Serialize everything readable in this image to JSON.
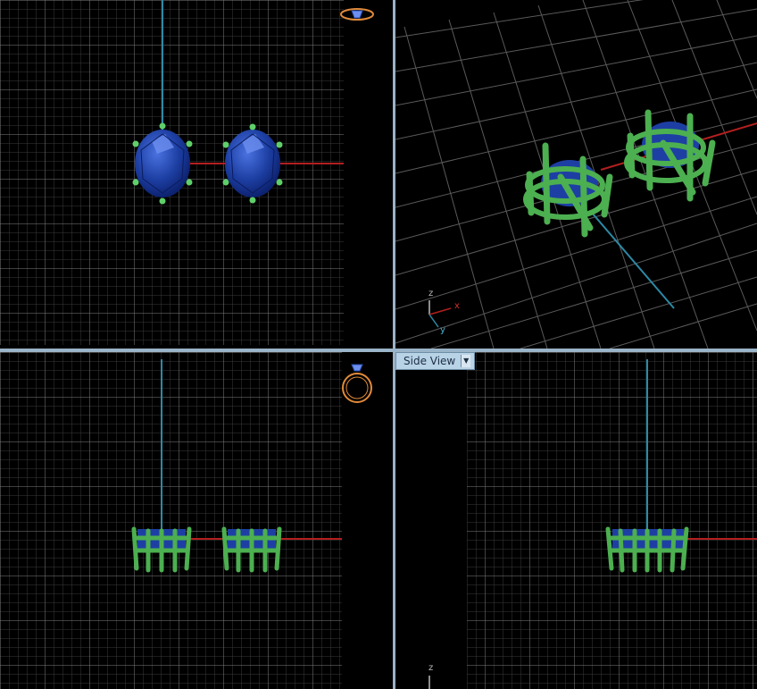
{
  "views": {
    "side_view": {
      "label": "Side View"
    }
  },
  "axis_labels": {
    "x": "x",
    "y": "y",
    "z": "z"
  },
  "colors": {
    "background": "#000000",
    "grid_minor": "#3a3a3a",
    "grid_major": "#8a8a8a",
    "x_axis": "#b21f1f",
    "y_axis": "#2c8aa6",
    "gem": "#1d3fa3",
    "metal": "#4caf50",
    "divider": "#9ab4c8",
    "gizmo": "#e08a3a"
  },
  "icons": {
    "top_gizmo": "ring-top-icon",
    "front_gizmo": "ring-front-icon",
    "view_dropdown": "chevron-down-icon"
  }
}
